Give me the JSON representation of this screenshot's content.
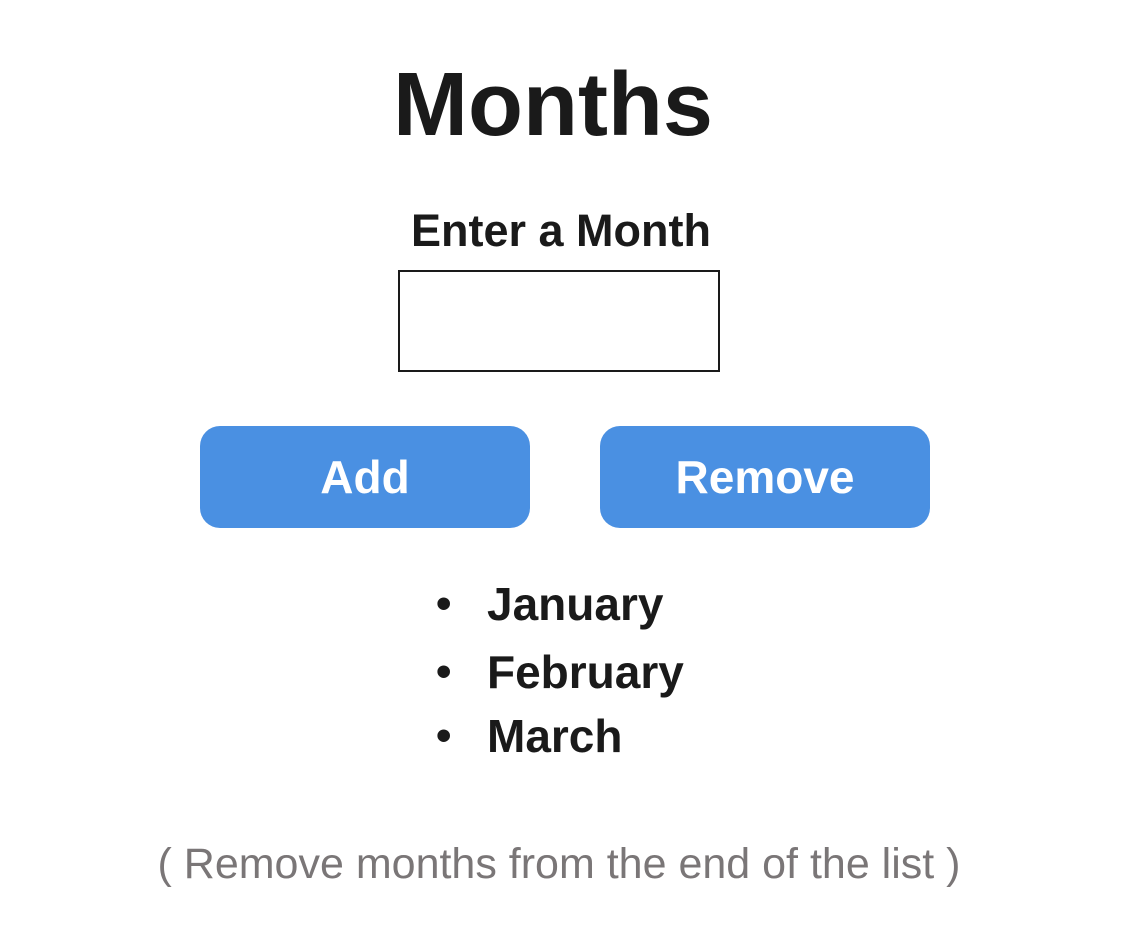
{
  "title": "Months",
  "input": {
    "label": "Enter a Month",
    "value": "",
    "placeholder": ""
  },
  "buttons": {
    "add_label": "Add",
    "remove_label": "Remove"
  },
  "months": [
    {
      "bullet": "•",
      "name": "January"
    },
    {
      "bullet": "•",
      "name": "February"
    },
    {
      "bullet": "•",
      "name": "March"
    }
  ],
  "hint": "( Remove months from the end of the list )",
  "colors": {
    "button_background": "#4a90e2",
    "button_text": "#ffffff",
    "text_primary": "#1a1a1a",
    "hint_text": "#7a7677"
  }
}
